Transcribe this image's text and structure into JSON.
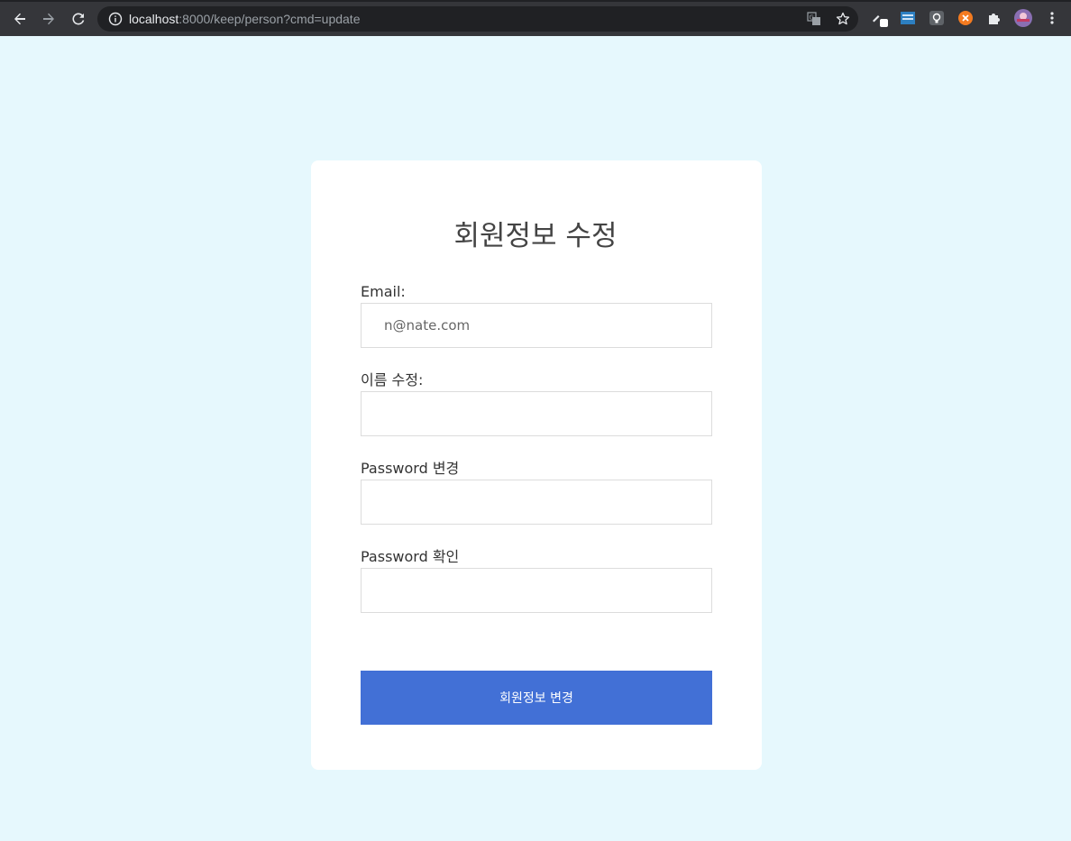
{
  "browser": {
    "url_host": "localhost",
    "url_path": ":8000/keep/person?cmd=update",
    "icons": [
      "back-icon",
      "forward-icon",
      "reload-icon",
      "info-icon",
      "translate-icon",
      "star-icon",
      "pen-icon",
      "extension-icon",
      "bulb-icon",
      "orange-extension-icon",
      "puzzle-icon",
      "profile-avatar",
      "kebab-menu-icon"
    ],
    "colors": {
      "toolbar": "#35363a",
      "omnibox": "#202124"
    }
  },
  "page": {
    "title": "회원정보 수정",
    "fields": {
      "email": {
        "label": "Email:",
        "placeholder": "n@nate.com"
      },
      "name": {
        "label": "이름 수정:",
        "placeholder": ""
      },
      "password": {
        "label": "Password 변경",
        "placeholder": ""
      },
      "password_confirm": {
        "label": "Password 확인",
        "placeholder": ""
      }
    },
    "submit_label": "회원정보 변경",
    "colors": {
      "background": "#e6f8fd",
      "button": "#4270d6",
      "card": "#ffffff"
    }
  }
}
